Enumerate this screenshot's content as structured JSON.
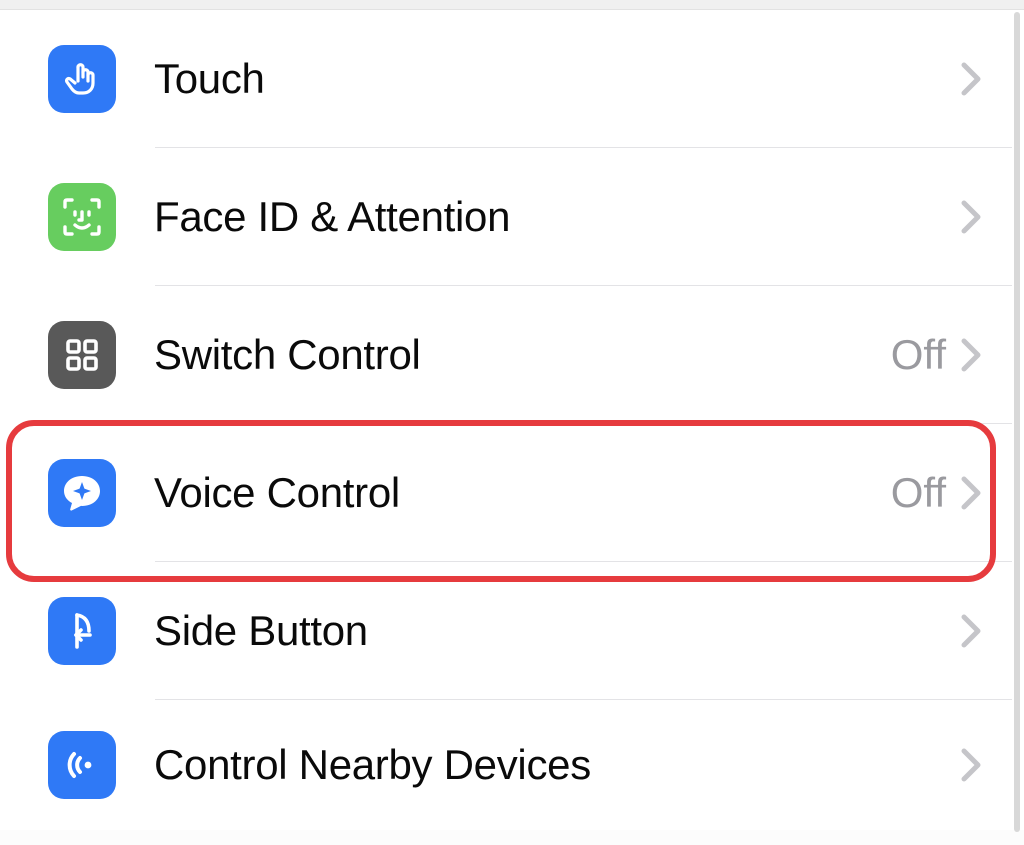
{
  "rows": [
    {
      "id": "touch",
      "label": "Touch",
      "value": "",
      "icon": "touch-icon",
      "icon_bg": "icon-blue"
    },
    {
      "id": "faceid",
      "label": "Face ID & Attention",
      "value": "",
      "icon": "faceid-icon",
      "icon_bg": "icon-green"
    },
    {
      "id": "switch-control",
      "label": "Switch Control",
      "value": "Off",
      "icon": "switch-grid-icon",
      "icon_bg": "icon-gray"
    },
    {
      "id": "voice-control",
      "label": "Voice Control",
      "value": "Off",
      "icon": "voice-control-icon",
      "icon_bg": "icon-blue"
    },
    {
      "id": "side-button",
      "label": "Side Button",
      "value": "",
      "icon": "side-button-icon",
      "icon_bg": "icon-blue"
    },
    {
      "id": "nearby",
      "label": "Control Nearby Devices",
      "value": "",
      "icon": "nearby-icon",
      "icon_bg": "icon-blue"
    }
  ],
  "highlighted_row": "voice-control",
  "colors": {
    "blue": "#2f79f6",
    "green": "#67cd5f",
    "dark_gray": "#595959",
    "chevron": "#c5c5c9",
    "value_gray": "#9a9a9f",
    "highlight_border": "#e63b3e"
  }
}
